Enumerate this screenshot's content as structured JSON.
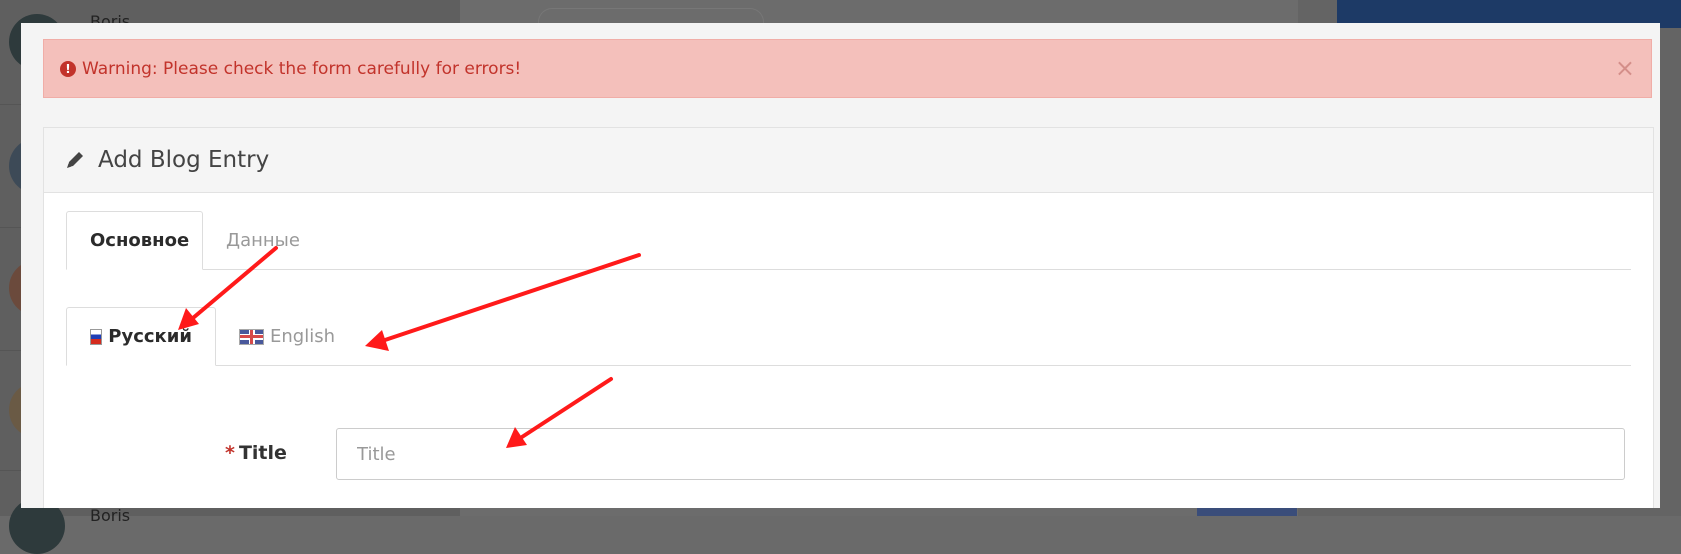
{
  "background": {
    "contacts": [
      {
        "name": "Boris",
        "avatar_color": "#2e3a3c"
      },
      {
        "name": "",
        "avatar_color": "#3d4a57"
      },
      {
        "name": "",
        "avatar_color": "#6b4a3c"
      },
      {
        "name": "",
        "avatar_color": "#6a5a45"
      },
      {
        "name": "Boris",
        "avatar_color": "#3b6b3b"
      }
    ]
  },
  "alert": {
    "icon": "exclamation-circle-icon",
    "text": "Warning: Please check the form carefully for errors!",
    "close": "×"
  },
  "panel": {
    "icon": "pencil-icon",
    "title": "Add Blog Entry"
  },
  "tabs": [
    {
      "label": "Основное",
      "active": true
    },
    {
      "label": "Данные",
      "active": false
    }
  ],
  "language_tabs": [
    {
      "label": "Русский",
      "flag": "flag-ru-icon",
      "active": true
    },
    {
      "label": "English",
      "flag": "flag-gb-icon",
      "active": false
    }
  ],
  "form": {
    "title_label": "Title",
    "required_mark": "*",
    "title_placeholder": "Title",
    "title_value": ""
  },
  "colors": {
    "alert_bg": "#f4c0bb",
    "alert_text": "#c2332b",
    "annotation_arrow": "#ff1a1a"
  }
}
